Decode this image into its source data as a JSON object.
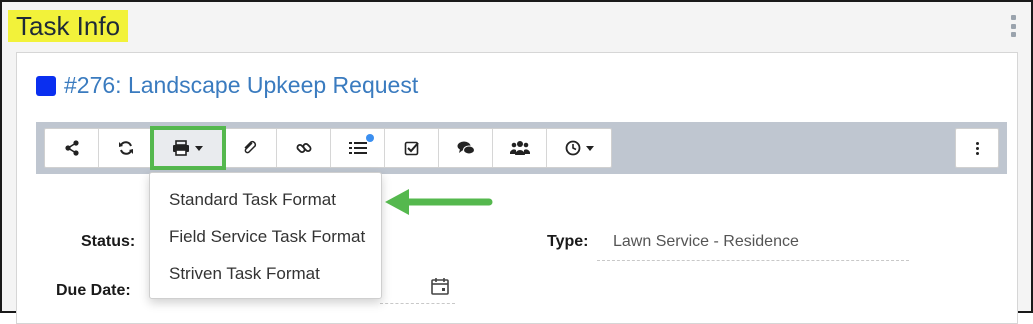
{
  "panel": {
    "title": "Task Info",
    "menu_icon": "kebab-vertical-icon"
  },
  "task": {
    "title": "#276: Landscape Upkeep Request",
    "color": "#0a2ff0"
  },
  "toolbar": {
    "buttons": [
      {
        "name": "share-icon"
      },
      {
        "name": "refresh-icon"
      },
      {
        "name": "print-icon",
        "has_caret": true,
        "active": true
      },
      {
        "name": "paperclip-icon"
      },
      {
        "name": "link-icon"
      },
      {
        "name": "list-icon",
        "has_badge": true
      },
      {
        "name": "checkbox-icon"
      },
      {
        "name": "comment-icon"
      },
      {
        "name": "users-icon"
      },
      {
        "name": "clock-icon",
        "has_caret": true
      }
    ],
    "more_icon": "kebab-vertical-icon",
    "highlight_color": "#55b84e"
  },
  "print_menu": {
    "items": [
      "Standard Task Format",
      "Field Service Task Format",
      "Striven Task Format"
    ]
  },
  "fields": {
    "status_label": "Status:",
    "type_label": "Type:",
    "type_value": "Lawn Service - Residence",
    "due_date_label": "Due Date:",
    "due_date_icon": "calendar-icon"
  },
  "annotation": {
    "arrow_color": "#55b84e"
  }
}
